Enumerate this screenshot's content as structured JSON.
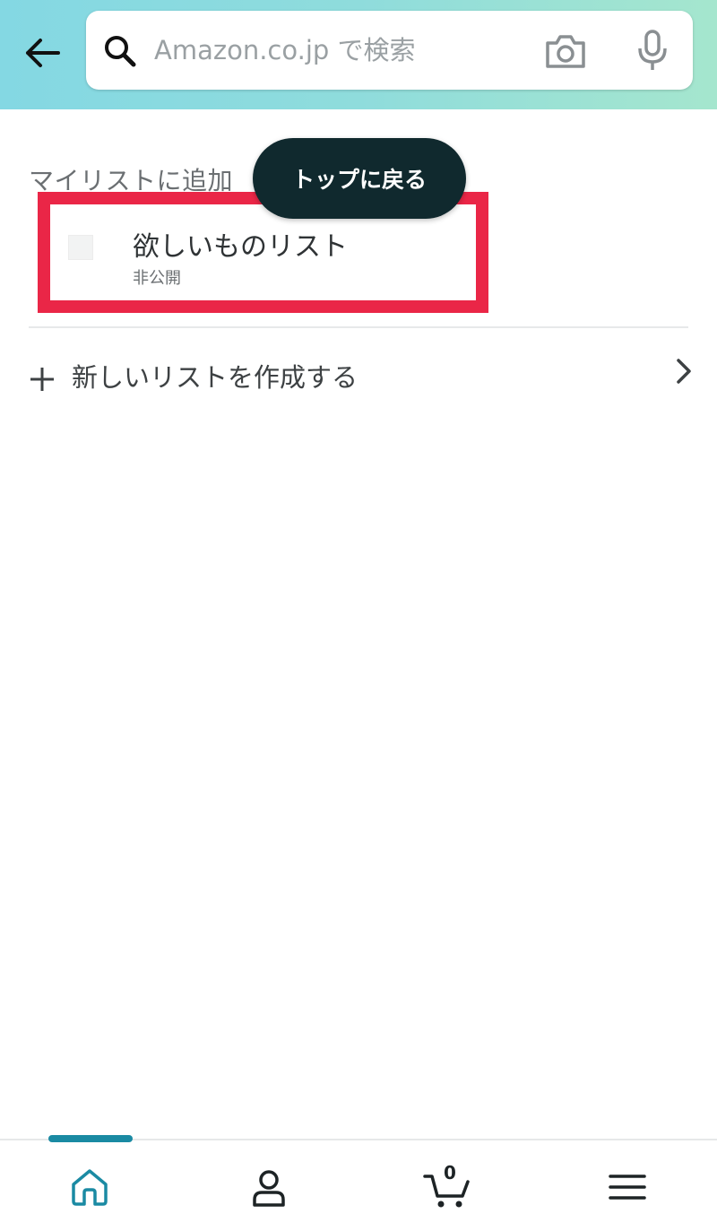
{
  "header": {
    "search": {
      "placeholder": "Amazon.co.jp で検索"
    },
    "icons": {
      "back": "arrow-left-icon",
      "search": "search-icon",
      "camera": "camera-icon",
      "mic": "microphone-icon"
    }
  },
  "main": {
    "section_title": "マイリストに追加",
    "toast_label": "トップに戻る",
    "lists": [
      {
        "name": "欲しいものリスト",
        "visibility": "非公開"
      }
    ],
    "create_list_label": "新しいリストを作成する"
  },
  "bottom_nav": {
    "cart_count": "0",
    "items": [
      {
        "icon": "home-icon",
        "active": true
      },
      {
        "icon": "account-icon",
        "active": false
      },
      {
        "icon": "cart-icon",
        "active": false
      },
      {
        "icon": "menu-icon",
        "active": false
      }
    ]
  },
  "colors": {
    "header_gradient_start": "#84d8e3",
    "header_gradient_end": "#a5e6ce",
    "highlight_border": "#ea2647",
    "toast_bg": "#10292e",
    "active_tab": "#1a8aa3"
  }
}
